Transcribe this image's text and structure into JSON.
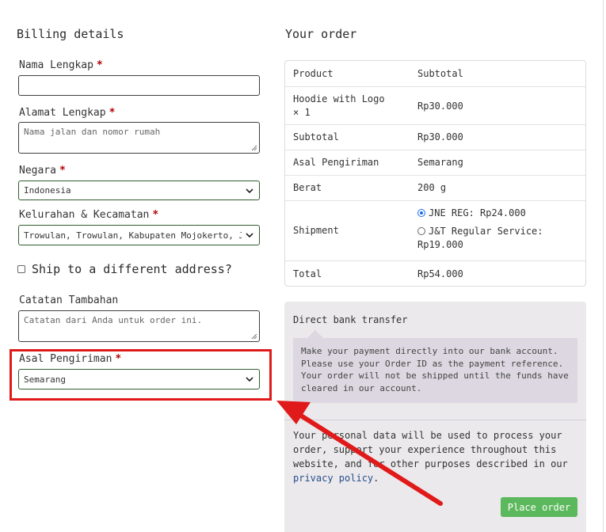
{
  "billing": {
    "heading": "Billing details",
    "required_mark": "*",
    "name_label": "Nama Lengkap",
    "name_value": "",
    "address_label": "Alamat Lengkap",
    "address_placeholder": "Nama jalan dan nomor rumah",
    "country_label": "Negara",
    "country_value": "Indonesia",
    "district_label": "Kelurahan & Kecamatan",
    "district_value": "Trowulan, Trowulan, Kabupaten Mojokerto, Jawa Timur",
    "ship_different_label": "Ship to a different address?",
    "notes_label": "Catatan Tambahan",
    "notes_placeholder": "Catatan dari Anda untuk order ini.",
    "origin_label": "Asal Pengiriman",
    "origin_value": "Semarang"
  },
  "order": {
    "heading": "Your order",
    "col_product": "Product",
    "col_subtotal": "Subtotal",
    "item_name_line1": "Hoodie with Logo",
    "item_name_line2": "× 1",
    "item_price": "Rp30.000",
    "subtotal_label": "Subtotal",
    "subtotal_value": "Rp30.000",
    "origin_label": "Asal Pengiriman",
    "origin_value": "Semarang",
    "weight_label": "Berat",
    "weight_value": "200 g",
    "shipment_label": "Shipment",
    "shipment_option1": "JNE REG: Rp24.000",
    "shipment_option2_line1": "J&T Regular Service:",
    "shipment_option2_line2": "Rp19.000",
    "total_label": "Total",
    "total_value": "Rp54.000"
  },
  "payment": {
    "method_title": "Direct bank transfer",
    "description": "Make your payment directly into our bank account. Please use your Order ID as the payment reference. Your order will not be shipped until the funds have cleared in our account.",
    "privacy_text": "Your personal data will be used to process your order, support your experience throughout this website, and for other purposes described in our",
    "privacy_link": "privacy policy",
    "privacy_end": ".",
    "place_order_label": "Place order"
  },
  "annotation": {
    "highlight_color": "#e01a1a",
    "arrow_color": "#e01a1a"
  }
}
